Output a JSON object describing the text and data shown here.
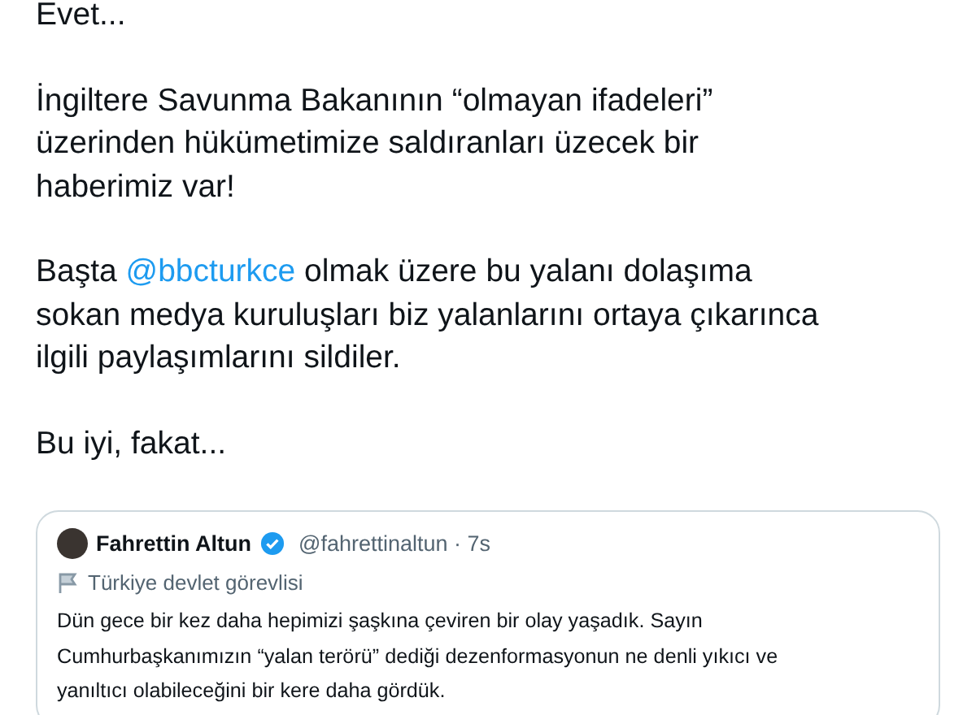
{
  "tweet": {
    "paragraphs": [
      {
        "lines": [
          [
            {
              "kind": "text",
              "text": "Evet..."
            }
          ]
        ]
      },
      {
        "lines": [
          [
            {
              "kind": "text",
              "text": "İngiltere Savunma Bakanının “olmayan ifadeleri”"
            }
          ],
          [
            {
              "kind": "text",
              "text": "üzerinden hükümetimize saldıranları üzecek bir"
            }
          ],
          [
            {
              "kind": "text",
              "text": "haberimiz var!"
            }
          ]
        ]
      },
      {
        "lines": [
          [
            {
              "kind": "text",
              "text": "Başta "
            },
            {
              "kind": "mention",
              "text": "@bbcturkce"
            },
            {
              "kind": "text",
              "text": " olmak üzere bu yalanı dolaşıma"
            }
          ],
          [
            {
              "kind": "text",
              "text": "sokan medya kuruluşları biz yalanlarını ortaya çıkarınca"
            }
          ],
          [
            {
              "kind": "text",
              "text": "ilgili paylaşımlarını sildiler."
            }
          ]
        ]
      },
      {
        "lines": [
          [
            {
              "kind": "text",
              "text": "Bu iyi, fakat..."
            }
          ]
        ]
      }
    ]
  },
  "quoted_tweet": {
    "name": "Fahrettin Altun",
    "verified": true,
    "handle": "@fahrettinaltun · 7s",
    "label": "Türkiye devlet görevlisi",
    "lines": [
      "Dün gece bir kez daha hepimizi şaşkına çeviren bir olay yaşadık. Sayın",
      "Cumhurbaşkanımızın “yalan terörü” dediği dezenformasyonun ne denli yıkıcı ve",
      "yanıltıcı olabileceğini bir kere daha gördük."
    ]
  }
}
